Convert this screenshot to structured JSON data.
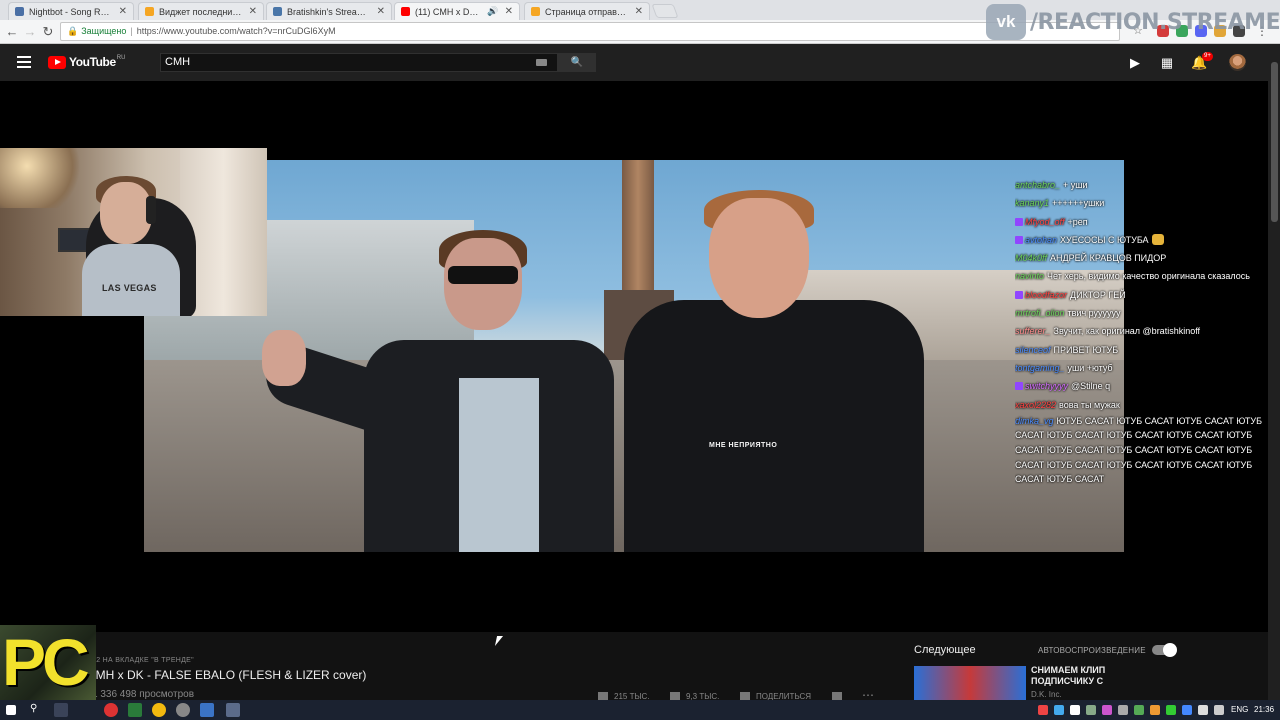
{
  "browser": {
    "tabs": [
      {
        "title": "Nightbot - Song Reques",
        "color": "#4a6fa5",
        "active": false
      },
      {
        "title": "Виджет последних сооб",
        "color": "#f5a623",
        "active": false
      },
      {
        "title": "Bratishkin's Stream [CS:G",
        "color": "#4a76a8",
        "active": false
      },
      {
        "title": "(11) CMH x DK - FALS",
        "color": "#ff0000",
        "active": true
      },
      {
        "title": "Страница отправки соо",
        "color": "#f5a623",
        "active": false
      }
    ],
    "secure_label": "Защищено",
    "url": "https://www.youtube.com/watch?v=nrCuDGl6XyM"
  },
  "watermark": {
    "icon": "vk-logo-icon",
    "text": "/REACTION.STREAMERS"
  },
  "youtube": {
    "logo_text": "YouTube",
    "region": "RU",
    "search_value": "CMH",
    "notification_count": "9+"
  },
  "chat": {
    "messages": [
      {
        "user": "antchabro_",
        "color": "#6bd35b",
        "text": "+ уши"
      },
      {
        "user": "kanany1",
        "color": "#6bd35b",
        "text": "++++++ушки"
      },
      {
        "user": "Mfyod_off",
        "color": "#ff4040",
        "text": "+реп",
        "badge": true
      },
      {
        "user": "avtohan",
        "color": "#4a8cff",
        "text": "ХУЕСОСЫ С ЮТУБА",
        "badge": true,
        "emote": true
      },
      {
        "user": "M04k0ff",
        "color": "#6bd35b",
        "text": "АНДРЕЙ КРАВЦОВ ПИДОР"
      },
      {
        "user": "navinto",
        "color": "#6bd35b",
        "text": "Чет херь, видимо качество оригинала сказалось"
      },
      {
        "user": "bloodfazor",
        "color": "#ff4040",
        "text": "ДИКТОР ГЕЙ",
        "badge": true
      },
      {
        "user": "mrtrofi_olion",
        "color": "#6bd35b",
        "text": "твич руууууу"
      },
      {
        "user": "sufferer_",
        "color": "#ff8c8c",
        "text": "Звучит, как оригинал @bratishkinoff"
      },
      {
        "user": "silenceof",
        "color": "#4a8cff",
        "text": "ПРИВЕТ ЮТУБ"
      },
      {
        "user": "tontgaming_",
        "color": "#4a8cff",
        "text": "уши +ютуб"
      },
      {
        "user": "switchyyyy",
        "color": "#d46bff",
        "text": "@Stilne q",
        "badge": true
      },
      {
        "user": "xaxol2282",
        "color": "#ff4040",
        "text": "вова ты мужак"
      },
      {
        "user": "dimka_vg",
        "color": "#4a8cff",
        "text": "ЮТУБ САСАТ ЮТУБ САСАТ ЮТУБ САСАТ ЮТУБ САСАТ ЮТУБ САСАТ ЮТУБ САСАТ ЮТУБ САСАТ ЮТУБ САСАТ ЮТУБ САСАТ ЮТУБ САСАТ ЮТУБ САСАТ ЮТУБ САСАТ ЮТУБ САСАТ ЮТУБ САСАТ ЮТУБ САСАТ ЮТУБ САСАТ ЮТУБ САСАТ",
        "spam": true
      }
    ]
  },
  "webcam": {
    "shirt_text": "LAS VEGAS"
  },
  "video_overlay_text": "МНЕ НЕПРИЯТНО",
  "video": {
    "trending_label": "#2 НА ВКЛАДКЕ \"В ТРЕНДЕ\"",
    "title": "CMH x DK - FALSE EBALO (FLESH & LIZER cover)",
    "views": "1 336 498 просмотров",
    "likes": "215 ТЫС.",
    "dislikes": "9,3 ТЫС.",
    "share": "ПОДЕЛИТЬСЯ"
  },
  "thumb_text": "PC",
  "sidebar": {
    "up_next": "Следующее",
    "autoplay": "АВТОВОСПРОИЗВЕДЕНИЕ",
    "autoplay_on": true,
    "next_title": "СНИМАЕМ КЛИП ПОДПИСЧИКУ С",
    "next_channel": "D.K. Inc."
  },
  "taskbar": {
    "lang": "ENG",
    "time": "21:36"
  }
}
